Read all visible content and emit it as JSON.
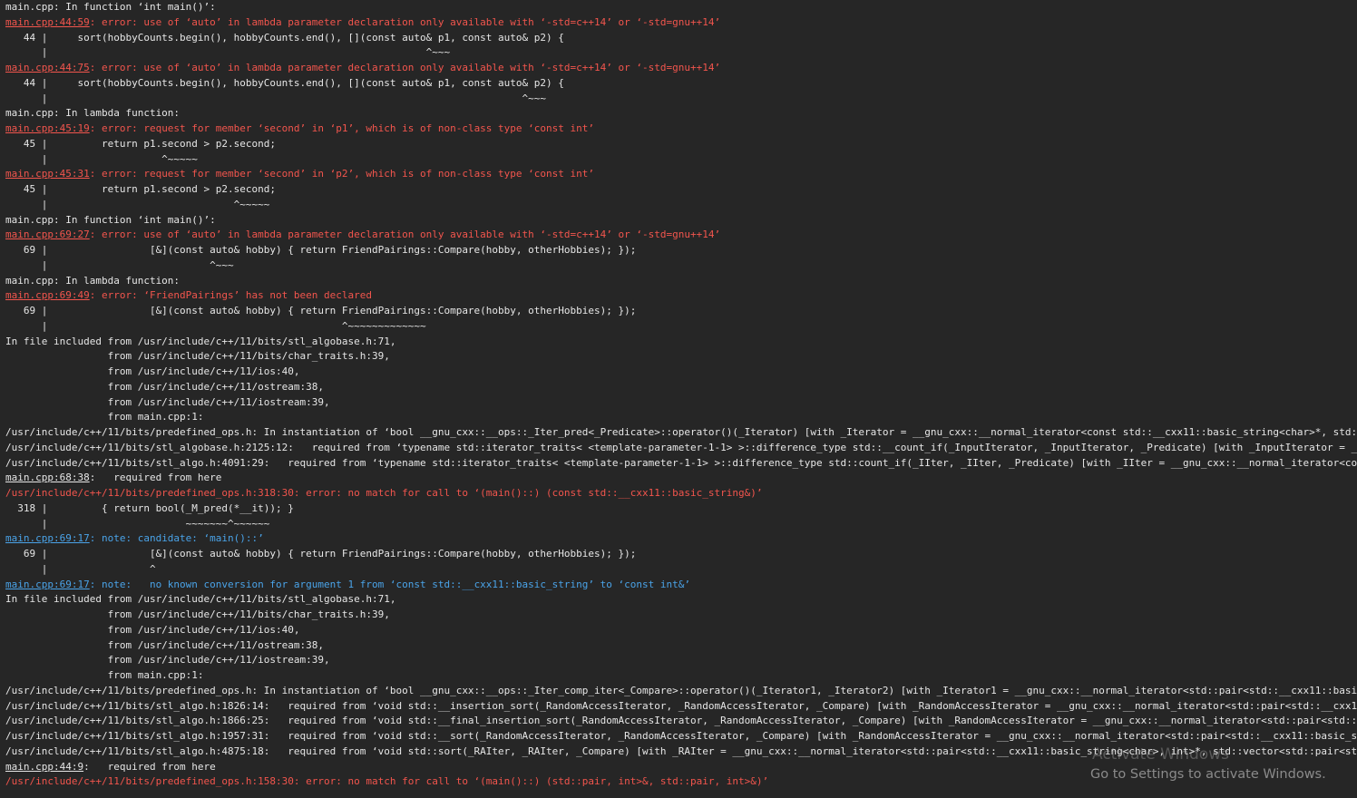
{
  "terminal_lines": [
    {
      "type": "plain",
      "text": "main.cpp: In function ‘int main()’:"
    },
    {
      "type": "error",
      "loc": "main.cpp:44:59",
      "msg": ": error: use of ‘auto’ in lambda parameter declaration only available with ‘-std=c++14’ or ‘-std=gnu++14’"
    },
    {
      "type": "plain",
      "text": "   44 |     sort(hobbyCounts.begin(), hobbyCounts.end(), [](const auto& p1, const auto& p2) {"
    },
    {
      "type": "plain",
      "text": "      |                                                               ^~~~"
    },
    {
      "type": "error",
      "loc": "main.cpp:44:75",
      "msg": ": error: use of ‘auto’ in lambda parameter declaration only available with ‘-std=c++14’ or ‘-std=gnu++14’"
    },
    {
      "type": "plain",
      "text": "   44 |     sort(hobbyCounts.begin(), hobbyCounts.end(), [](const auto& p1, const auto& p2) {"
    },
    {
      "type": "plain",
      "text": "      |                                                                               ^~~~"
    },
    {
      "type": "plain",
      "text": "main.cpp: In lambda function:"
    },
    {
      "type": "error",
      "loc": "main.cpp:45:19",
      "msg": ": error: request for member ‘second’ in ‘p1’, which is of non-class type ‘const int’"
    },
    {
      "type": "plain",
      "text": "   45 |         return p1.second > p2.second;"
    },
    {
      "type": "plain",
      "text": "      |                   ^~~~~~"
    },
    {
      "type": "error",
      "loc": "main.cpp:45:31",
      "msg": ": error: request for member ‘second’ in ‘p2’, which is of non-class type ‘const int’"
    },
    {
      "type": "plain",
      "text": "   45 |         return p1.second > p2.second;"
    },
    {
      "type": "plain",
      "text": "      |                               ^~~~~~"
    },
    {
      "type": "plain",
      "text": "main.cpp: In function ‘int main()’:"
    },
    {
      "type": "error",
      "loc": "main.cpp:69:27",
      "msg": ": error: use of ‘auto’ in lambda parameter declaration only available with ‘-std=c++14’ or ‘-std=gnu++14’"
    },
    {
      "type": "plain",
      "text": "   69 |                 [&](const auto& hobby) { return FriendPairings::Compare(hobby, otherHobbies); });"
    },
    {
      "type": "plain",
      "text": "      |                           ^~~~"
    },
    {
      "type": "plain",
      "text": "main.cpp: In lambda function:"
    },
    {
      "type": "error",
      "loc": "main.cpp:69:49",
      "msg": ": error: ‘FriendPairings’ has not been declared"
    },
    {
      "type": "plain",
      "text": "   69 |                 [&](const auto& hobby) { return FriendPairings::Compare(hobby, otherHobbies); });"
    },
    {
      "type": "plain",
      "text": "      |                                                 ^~~~~~~~~~~~~~"
    },
    {
      "type": "plain",
      "text": "In file included from /usr/include/c++/11/bits/stl_algobase.h:71,"
    },
    {
      "type": "plain",
      "text": "                 from /usr/include/c++/11/bits/char_traits.h:39,"
    },
    {
      "type": "plain",
      "text": "                 from /usr/include/c++/11/ios:40,"
    },
    {
      "type": "plain",
      "text": "                 from /usr/include/c++/11/ostream:38,"
    },
    {
      "type": "plain",
      "text": "                 from /usr/include/c++/11/iostream:39,"
    },
    {
      "type": "plain",
      "text": "                 from main.cpp:1:"
    },
    {
      "type": "plain",
      "text": "/usr/include/c++/11/bits/predefined_ops.h: In instantiation of ‘bool __gnu_cxx::__ops::_Iter_pred<_Predicate>::operator()(_Iterator) [with _Iterator = __gnu_cxx::__normal_iterator<const std::__cxx11::basic_string<char>*, std::vector"
    },
    {
      "type": "plain",
      "text": "/usr/include/c++/11/bits/stl_algobase.h:2125:12:   required from ‘typename std::iterator_traits< <template-parameter-1-1> >::difference_type std::__count_if(_InputIterator, _InputIterator, _Predicate) [with _InputIterator = __gnu_c"
    },
    {
      "type": "plain",
      "text": "/usr/include/c++/11/bits/stl_algo.h:4091:29:   required from ‘typename std::iterator_traits< <template-parameter-1-1> >::difference_type std::count_if(_IIter, _IIter, _Predicate) [with _IIter = __gnu_cxx::__normal_iterator<const std"
    },
    {
      "type": "loc-plain",
      "loc": "main.cpp:68:38",
      "msg": ":   required from here"
    },
    {
      "type": "red-plain",
      "text": "/usr/include/c++/11/bits/predefined_ops.h:318:30: error: no match for call to ‘(main()::) (const std::__cxx11::basic_string&)’"
    },
    {
      "type": "plain",
      "text": "  318 |         { return bool(_M_pred(*__it)); }"
    },
    {
      "type": "plain",
      "text": "      |                       ~~~~~~~^~~~~~~"
    },
    {
      "type": "note",
      "loc": "main.cpp:69:17",
      "msg": ": note: candidate: ‘main()::’"
    },
    {
      "type": "plain",
      "text": "   69 |                 [&](const auto& hobby) { return FriendPairings::Compare(hobby, otherHobbies); });"
    },
    {
      "type": "plain",
      "text": "      |                 ^"
    },
    {
      "type": "note",
      "loc": "main.cpp:69:17",
      "msg": ": note:   no known conversion for argument 1 from ‘const std::__cxx11::basic_string’ to ‘const int&’"
    },
    {
      "type": "plain",
      "text": "In file included from /usr/include/c++/11/bits/stl_algobase.h:71,"
    },
    {
      "type": "plain",
      "text": "                 from /usr/include/c++/11/bits/char_traits.h:39,"
    },
    {
      "type": "plain",
      "text": "                 from /usr/include/c++/11/ios:40,"
    },
    {
      "type": "plain",
      "text": "                 from /usr/include/c++/11/ostream:38,"
    },
    {
      "type": "plain",
      "text": "                 from /usr/include/c++/11/iostream:39,"
    },
    {
      "type": "plain",
      "text": "                 from main.cpp:1:"
    },
    {
      "type": "plain",
      "text": "/usr/include/c++/11/bits/predefined_ops.h: In instantiation of ‘bool __gnu_cxx::__ops::_Iter_comp_iter<_Compare>::operator()(_Iterator1, _Iterator2) [with _Iterator1 = __gnu_cxx::__normal_iterator<std::pair<std::__cxx11::basic_strin"
    },
    {
      "type": "plain",
      "text": "/usr/include/c++/11/bits/stl_algo.h:1826:14:   required from ‘void std::__insertion_sort(_RandomAccessIterator, _RandomAccessIterator, _Compare) [with _RandomAccessIterator = __gnu_cxx::__normal_iterator<std::pair<std::__cxx11::basi"
    },
    {
      "type": "plain",
      "text": "/usr/include/c++/11/bits/stl_algo.h:1866:25:   required from ‘void std::__final_insertion_sort(_RandomAccessIterator, _RandomAccessIterator, _Compare) [with _RandomAccessIterator = __gnu_cxx::__normal_iterator<std::pair<std::__cxx11"
    },
    {
      "type": "plain",
      "text": "/usr/include/c++/11/bits/stl_algo.h:1957:31:   required from ‘void std::__sort(_RandomAccessIterator, _RandomAccessIterator, _Compare) [with _RandomAccessIterator = __gnu_cxx::__normal_iterator<std::pair<std::__cxx11::basic_string<c"
    },
    {
      "type": "plain",
      "text": "/usr/include/c++/11/bits/stl_algo.h:4875:18:   required from ‘void std::sort(_RAIter, _RAIter, _Compare) [with _RAIter = __gnu_cxx::__normal_iterator<std::pair<std::__cxx11::basic_string<char>, int>*, std::vector<std::pair<std::__c"
    },
    {
      "type": "loc-plain",
      "loc": "main.cpp:44:9",
      "msg": ":   required from here"
    },
    {
      "type": "red-plain",
      "text": "/usr/include/c++/11/bits/predefined_ops.h:158:30: error: no match for call to ‘(main()::) (std::pair, int>&, std::pair, int>&)’"
    }
  ],
  "watermark": {
    "title": "Activate Windows",
    "subtitle": "Go to Settings to activate Windows."
  }
}
